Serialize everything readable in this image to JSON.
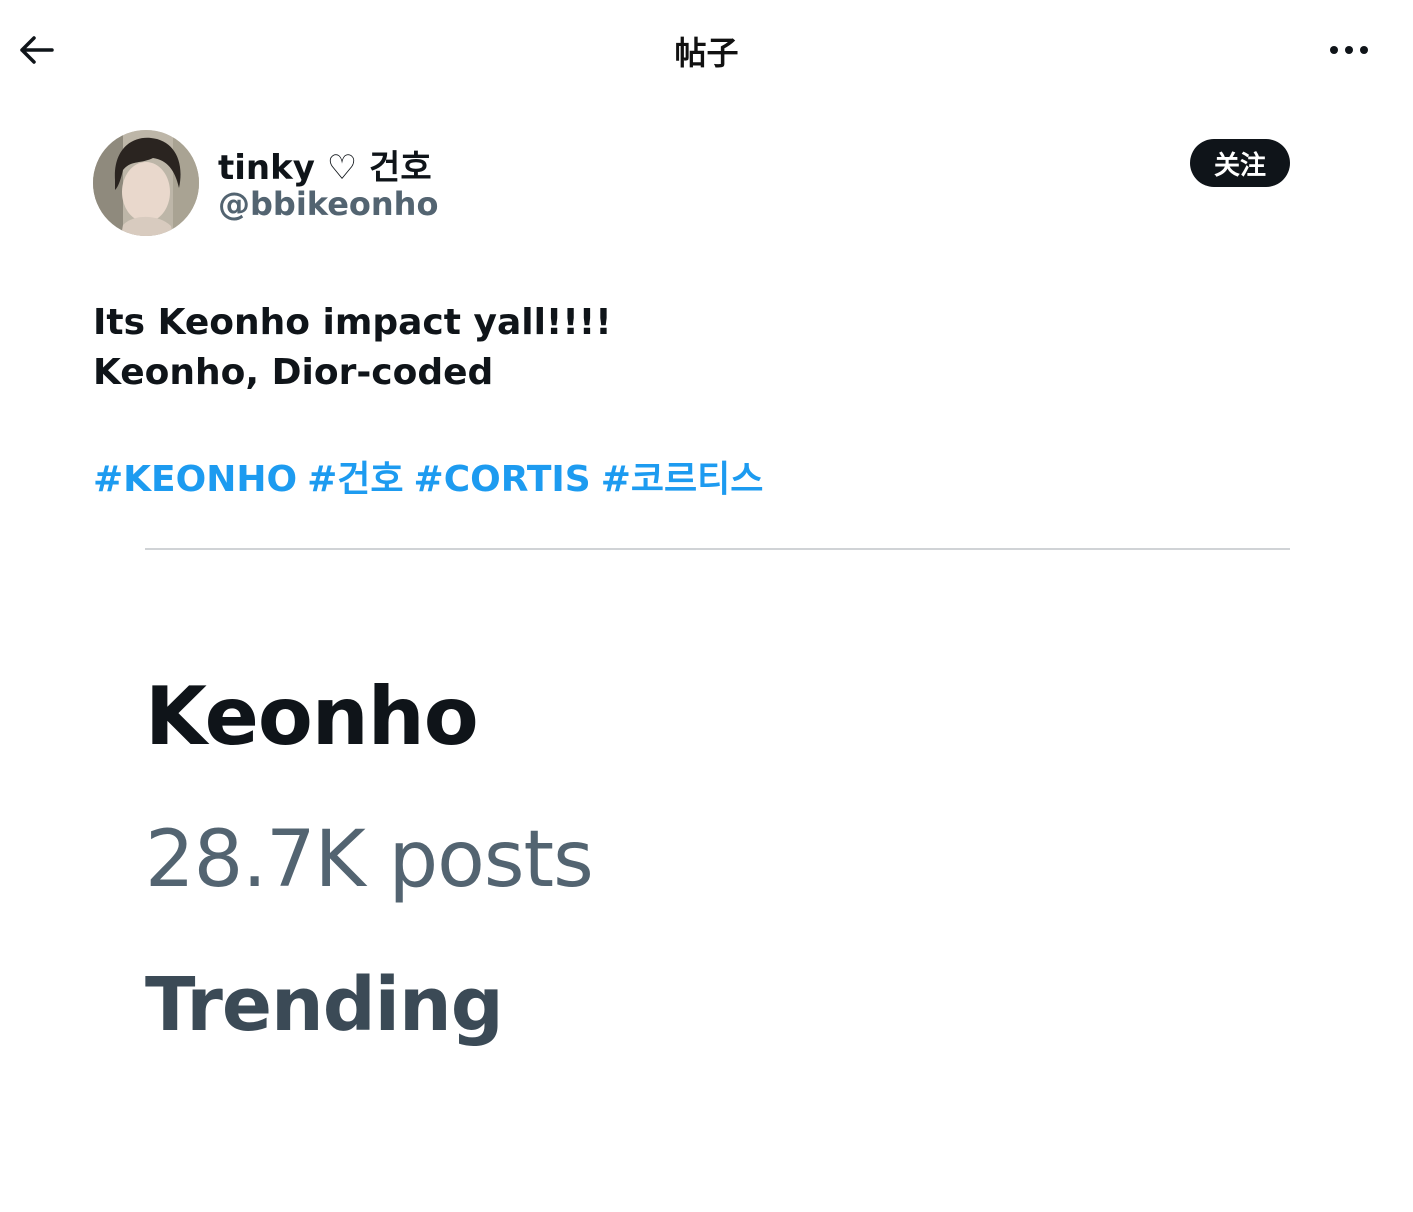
{
  "header": {
    "title": "帖子",
    "back_icon": "arrow-left-icon",
    "more_icon": "more-horizontal-icon"
  },
  "author": {
    "display_name": "tinky ♡ 건호",
    "handle": "@bbikeonho",
    "follow_label": "关注"
  },
  "post": {
    "line1": "Its Keonho impact yall!!!!",
    "line2": "Keonho, Dior-coded",
    "hashtags": [
      "#KEONHO",
      "#건호",
      "#CORTIS",
      "#코르티스"
    ]
  },
  "embedded_image": {
    "title": "Keonho",
    "count": "28.7K posts",
    "status": "Trending"
  },
  "colors": {
    "accent": "#1d9bf0",
    "text": "#0f1419",
    "secondary": "#536471",
    "button_bg": "#0f1419"
  }
}
